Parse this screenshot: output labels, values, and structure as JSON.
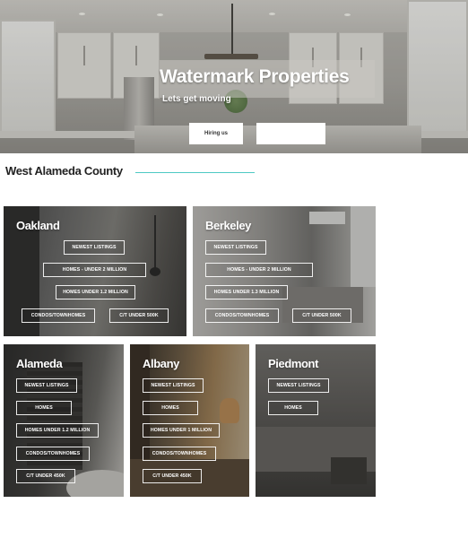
{
  "hero": {
    "title": "Watermark Properties",
    "subtitle": "Lets get moving",
    "primary_button": "Hiring us",
    "secondary_button": ""
  },
  "section": {
    "title": "West Alameda County",
    "accent_color": "#4ec9c4"
  },
  "cards": {
    "oakland": {
      "title": "Oakland",
      "links": [
        "NEWEST LISTINGS",
        "HOMES - UNDER 2 MILLION",
        "HOMES UNDER 1.2 MILLION",
        "CONDOS/TOWNHOMES",
        "C/T UNDER 500k"
      ]
    },
    "berkeley": {
      "title": "Berkeley",
      "links": [
        "NEWEST LISTINGS",
        "HOMES - UNDER 2 MILLION",
        "HOMES UNDER 1.3 MILLION",
        "CONDOS/TOWNHOMES",
        "C/T UNDER 500K"
      ]
    },
    "alameda": {
      "title": "Alameda",
      "links": [
        "NEWEST LISTINGS",
        "HOMES",
        "HOMES UNDER 1.2 MILLION",
        "CONDOS/TOWNHOMES",
        "C/T UNDER 450K"
      ]
    },
    "albany": {
      "title": "Albany",
      "links": [
        "NEWEST LISTINGS",
        "HOMES",
        "HOMES UNDER 1 MILLION",
        "CONDOS/TOWNHOMES",
        "C/T UNDER 450K"
      ]
    },
    "piedmont": {
      "title": "Piedmont",
      "links": [
        "NEWEST LISTINGS",
        "HOMES"
      ]
    }
  }
}
